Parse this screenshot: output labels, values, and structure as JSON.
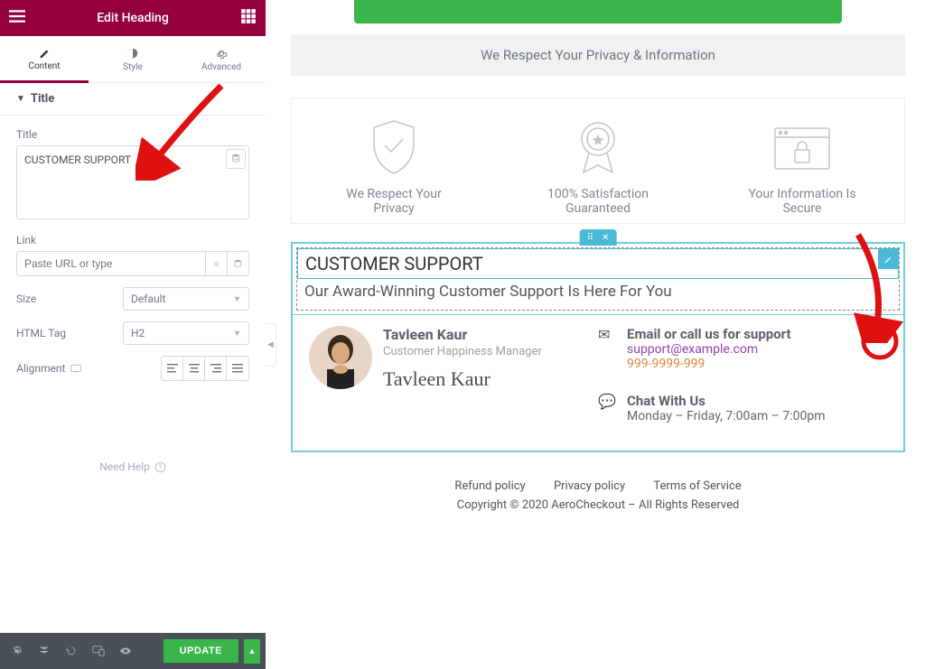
{
  "sidebar": {
    "header_title": "Edit Heading",
    "tabs": {
      "content": "Content",
      "style": "Style",
      "advanced": "Advanced"
    },
    "section_titles": {
      "title": "Title"
    },
    "controls": {
      "title_label": "Title",
      "title_value": "CUSTOMER SUPPORT",
      "link_label": "Link",
      "link_placeholder": "Paste URL or type",
      "size_label": "Size",
      "size_value": "Default",
      "html_tag_label": "HTML Tag",
      "html_tag_value": "H2",
      "alignment_label": "Alignment"
    },
    "need_help": "Need Help",
    "footer": {
      "update": "UPDATE"
    }
  },
  "canvas": {
    "privacy_bar": "We Respect Your Privacy & Information",
    "trust": [
      {
        "label_line1": "We Respect Your",
        "label_line2": "Privacy"
      },
      {
        "label_line1": "100% Satisfaction",
        "label_line2": "Guaranteed"
      },
      {
        "label_line1": "Your Information Is",
        "label_line2": "Secure"
      }
    ],
    "heading": "CUSTOMER SUPPORT",
    "subheading": "Our Award-Winning Customer Support Is Here For You",
    "person": {
      "name": "Tavleen Kaur",
      "role": "Customer Happiness Manager",
      "signature": "Tavleen Kaur"
    },
    "contacts": {
      "email_title": "Email or call us for support",
      "email_link": "support@example.com",
      "phone": "999-9999-999",
      "chat_title": "Chat With Us",
      "chat_hours": "Monday – Friday, 7:00am – 7:00pm"
    },
    "footer_links": [
      "Refund policy",
      "Privacy policy",
      "Terms of Service"
    ],
    "copyright": "Copyright © 2020 AeroCheckout – All Rights Reserved"
  }
}
